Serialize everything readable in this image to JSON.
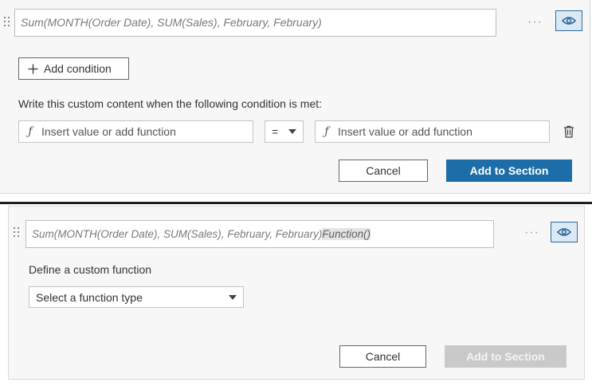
{
  "panel1": {
    "formula_text": "Sum(MONTH(Order Date), SUM(Sales), February, February)",
    "more_label": "···",
    "add_condition_label": "Add condition",
    "condition_prompt": "Write this custom content when the following condition is met:",
    "left_value_placeholder": "Insert value or add function",
    "operator_value": "=",
    "right_value_placeholder": "Insert value or add function",
    "cancel_label": "Cancel",
    "add_label": "Add to Section",
    "colors": {
      "primary": "#1d6ea8",
      "eye_bg": "#dbe9f5"
    },
    "icons": [
      "drag-handle-icon",
      "eye-icon",
      "plus-icon",
      "function-icon",
      "trash-icon",
      "caret-down-icon"
    ]
  },
  "panel2": {
    "formula_text": "Sum(MONTH(Order Date), SUM(Sales), February, February)",
    "formula_suffix": "Function()",
    "more_label": "···",
    "define_label": "Define a custom function",
    "function_type_value": "Select a function type",
    "cancel_label": "Cancel",
    "add_label": "Add to Section",
    "colors": {
      "disabled": "#c9c9c9"
    }
  }
}
